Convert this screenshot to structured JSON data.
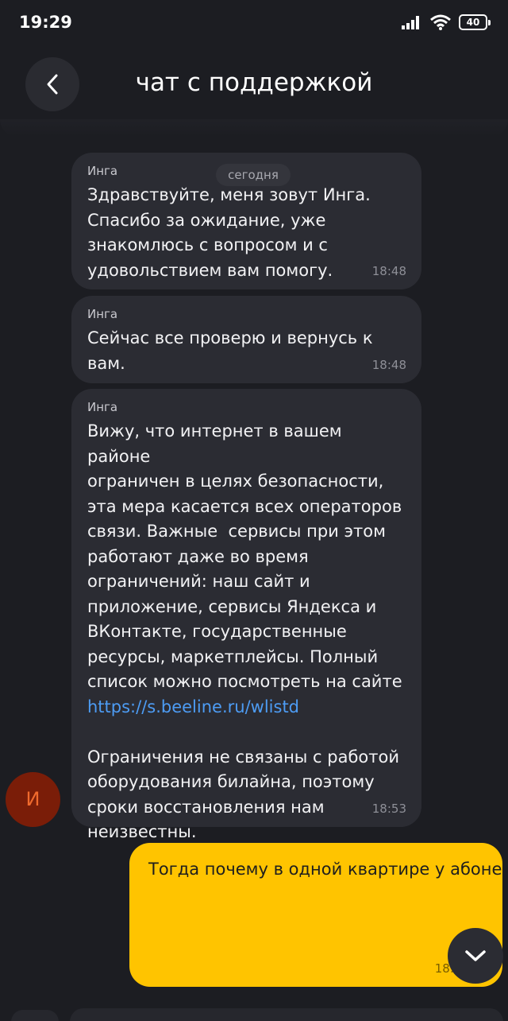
{
  "status": {
    "time": "19:29",
    "battery": "40"
  },
  "header": {
    "title": "чат с поддержкой"
  },
  "date_separator": "сегодня",
  "messages": [
    {
      "sender": "Инга",
      "text": "Здравствуйте, меня зовут Инга.\nСпасибо за ожидание, уже\nзнакомлюсь с вопросом и с\nудовольствием вам помогу.",
      "time": "18:48"
    },
    {
      "sender": "Инга",
      "text": "Сейчас все проверю и вернусь к\nвам.",
      "time": "18:48"
    },
    {
      "sender": "Инга",
      "text_a": "Вижу, что интернет в вашем районе\nограничен в целях безопасности,\nэта мера касается всех операторов\nсвязи. Важные  сервисы при этом\nработают даже во время\nограничений: наш сайт и\nприложение, сервисы Яндекса и\nВКонтакте, государственные\nресурсы, маркетплейсы. Полный\nсписок можно посмотреть на сайте",
      "link": "https://s.beeline.ru/wlistd",
      "text_b": "Ограничения не связаны с работой\nоборудования билайна, поэтому\nсроки восстановления нам\nнеизвестны.",
      "time": "18:53"
    }
  ],
  "agent_avatar": {
    "initial": "И"
  },
  "user_message": {
    "text": "Тогда почему в одной квартире у\nабонентов ты мобайл и Мегафона всё\nработает а у абонента Билайн не\nработает будьте любезны объясните",
    "time": "18:53"
  },
  "colors": {
    "background": "#1c1d22",
    "bubble": "#2b2c33",
    "user_bubble": "#ffc400",
    "link": "#4d9cf4",
    "avatar_bg": "#7a1d08"
  },
  "icons": {
    "back": "chevron-left-icon",
    "scroll_down": "chevron-down-icon",
    "signal": "signal-icon",
    "wifi": "wifi-icon",
    "battery": "battery-icon"
  }
}
